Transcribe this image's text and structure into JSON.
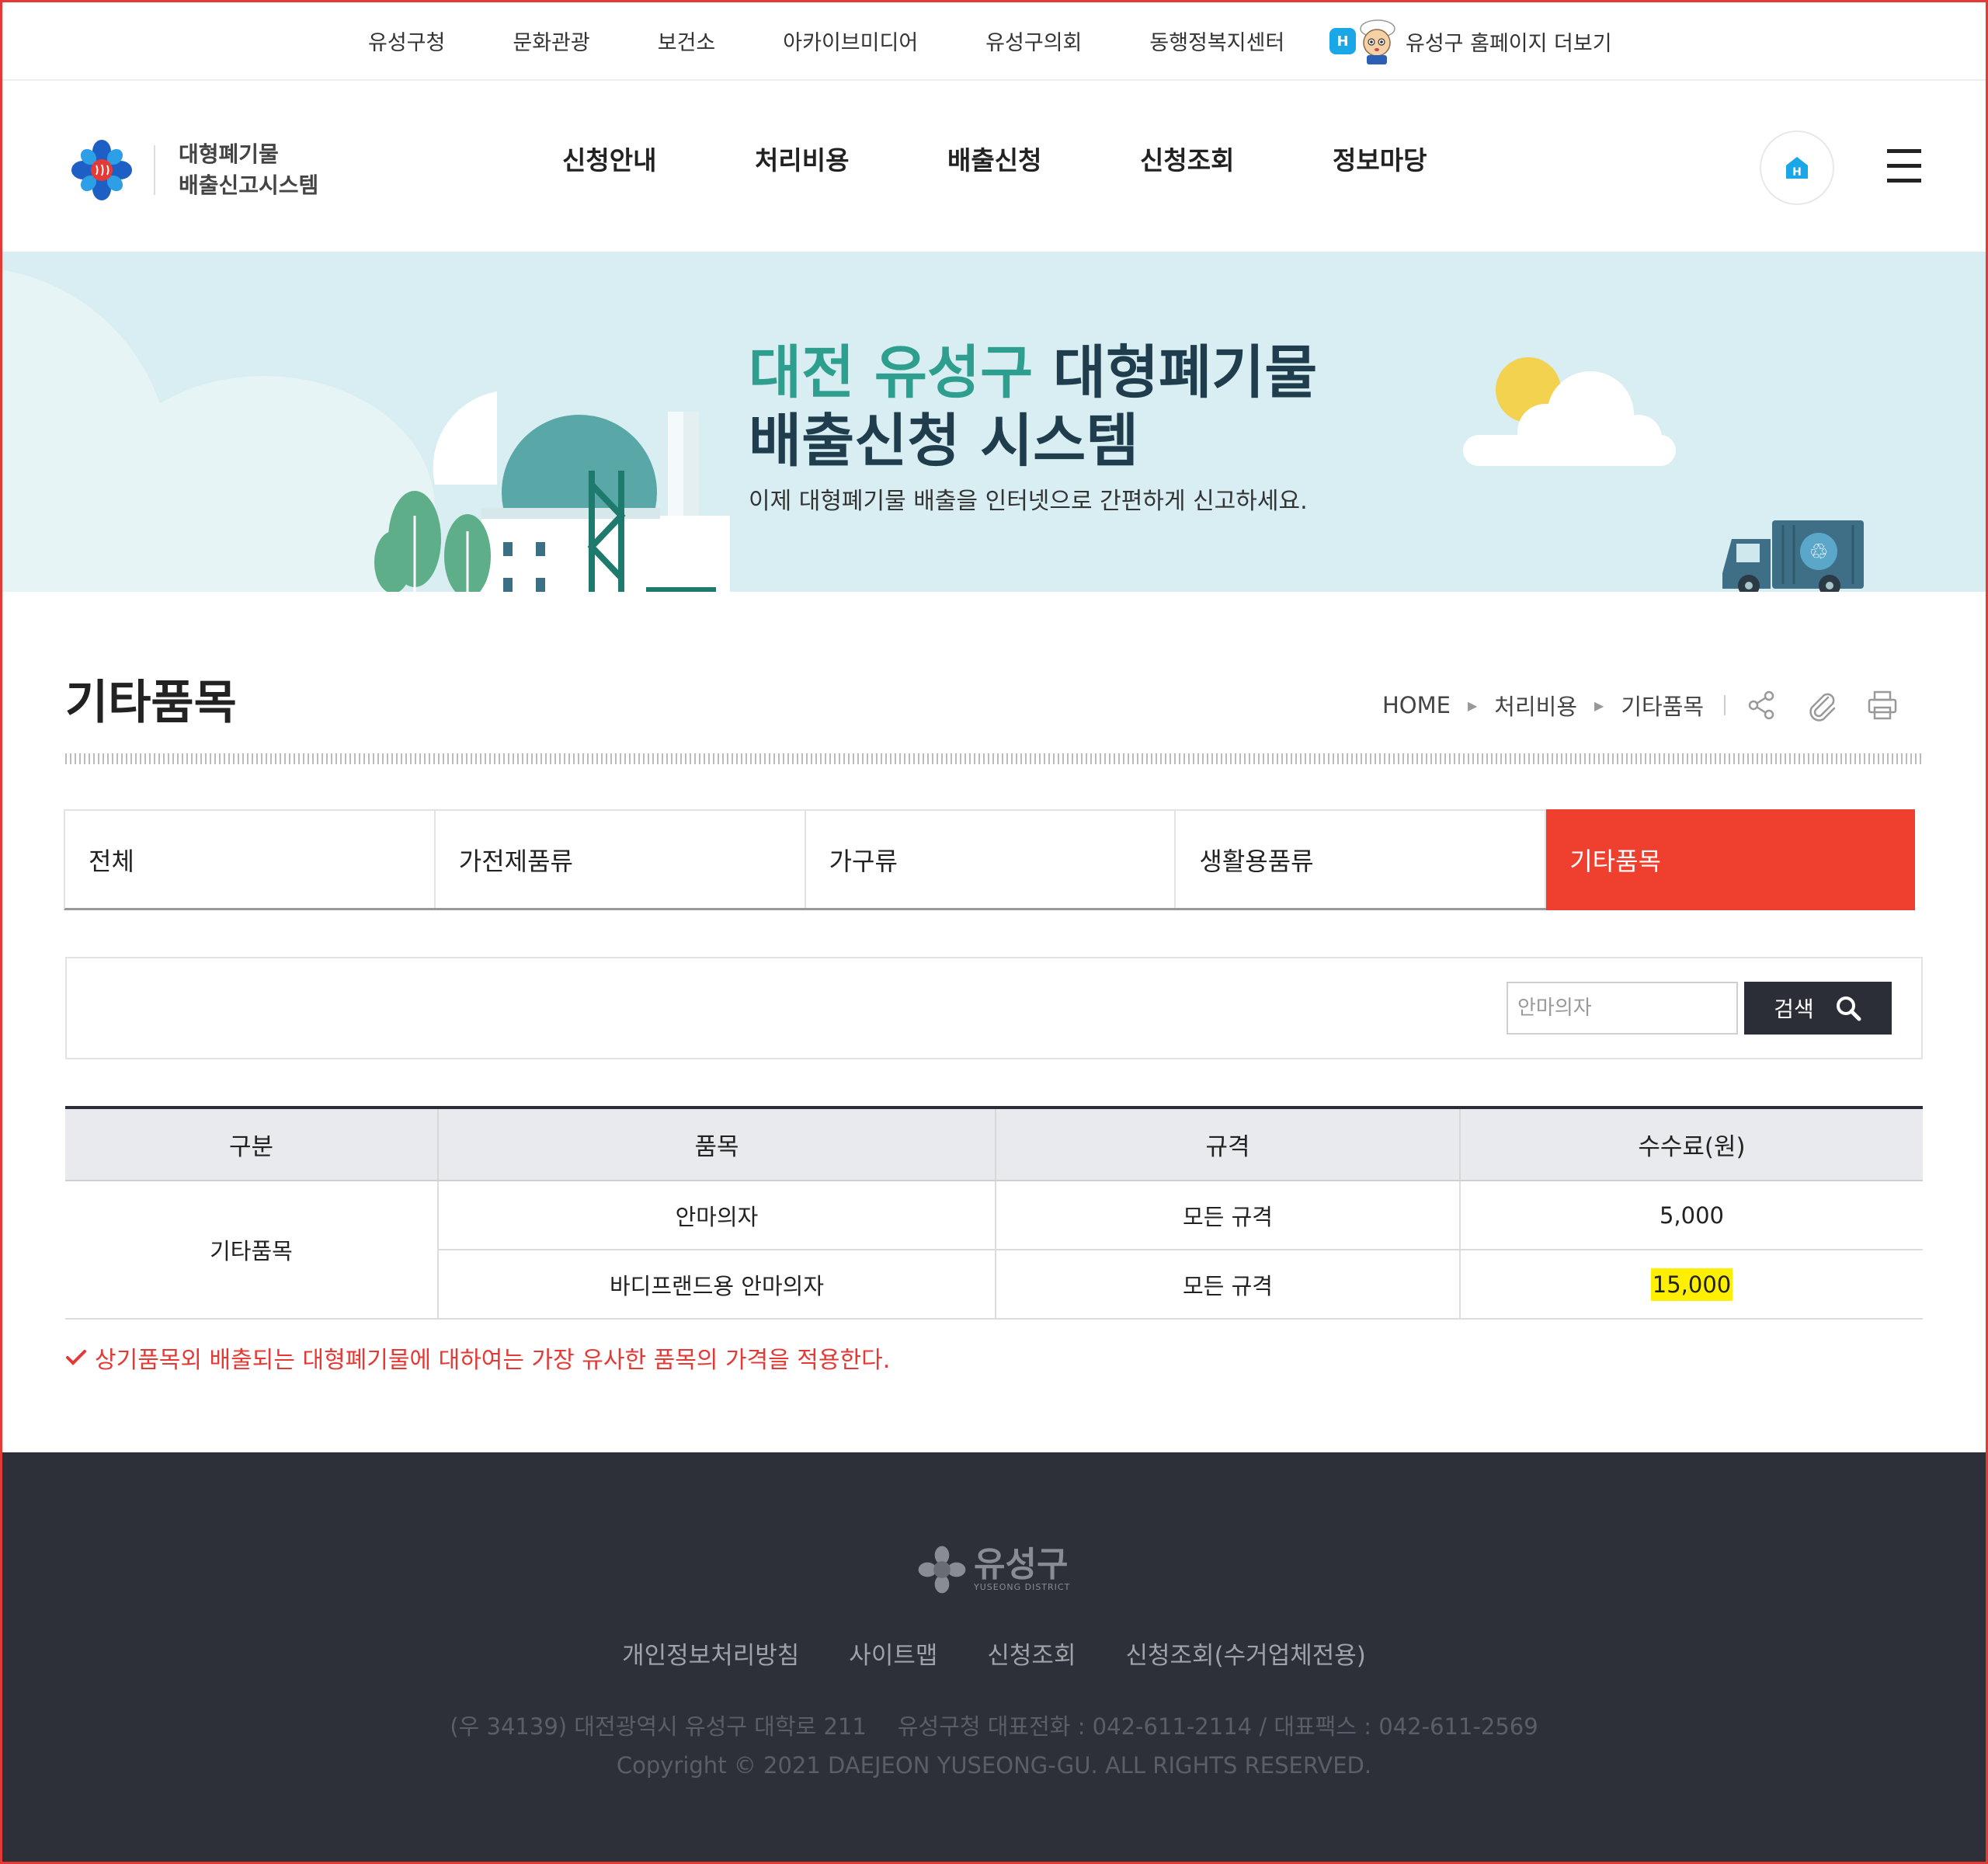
{
  "topbar": {
    "links": [
      "유성구청",
      "문화관광",
      "보건소",
      "아카이브미디어",
      "유성구의회",
      "동행정복지센터"
    ],
    "more_label": "유성구 홈페이지 더보기",
    "badge": "H"
  },
  "header": {
    "logo_line1": "대형폐기물",
    "logo_line2": "배출신고시스템",
    "nav": [
      "신청안내",
      "처리비용",
      "배출신청",
      "신청조회",
      "정보마당"
    ]
  },
  "banner": {
    "title_teal": "대전 유성구",
    "title_dark1": "대형폐기물",
    "title_dark2": "배출신청 시스템",
    "subtitle": "이제 대형폐기물 배출을 인터넷으로 간편하게 신고하세요."
  },
  "page": {
    "title": "기타품목",
    "breadcrumb": [
      "HOME",
      "처리비용",
      "기타품목"
    ]
  },
  "tabs": [
    {
      "label": "전체",
      "active": false
    },
    {
      "label": "가전제품류",
      "active": false
    },
    {
      "label": "가구류",
      "active": false
    },
    {
      "label": "생활용품류",
      "active": false
    },
    {
      "label": "기타품목",
      "active": true
    }
  ],
  "search": {
    "placeholder": "안마의자",
    "button_label": "검색"
  },
  "table": {
    "headers": [
      "구분",
      "품목",
      "규격",
      "수수료(원)"
    ],
    "category": "기타품목",
    "rows": [
      {
        "item": "안마의자",
        "spec": "모든 규격",
        "fee": "5,000"
      },
      {
        "item": "바디프랜드용 안마의자",
        "spec": "모든 규격",
        "fee": "15,000"
      }
    ]
  },
  "note": "상기품목외 배출되는 대형폐기물에 대하여는 가장 유사한 품목의 가격을 적용한다.",
  "footer": {
    "logo_name": "유성구",
    "logo_en": "YUSEONG DISTRICT",
    "links": [
      "개인정보처리방침",
      "사이트맵",
      "신청조회",
      "신청조회(수거업체전용)"
    ],
    "address": "(우 34139) 대전광역시 유성구 대학로 211",
    "phone": "유성구청 대표전화 : 042-611-2114 / 대표팩스 : 042-611-2569",
    "copyright": "Copyright © 2021 DAEJEON YUSEONG-GU. ALL RIGHTS RESERVED."
  },
  "colors": {
    "accent_red": "#ee3f2f",
    "banner_bg": "#d8eef2",
    "banner_teal": "#2e9e8f",
    "footer_bg": "#2e3039",
    "highlight": "#ffef00"
  }
}
